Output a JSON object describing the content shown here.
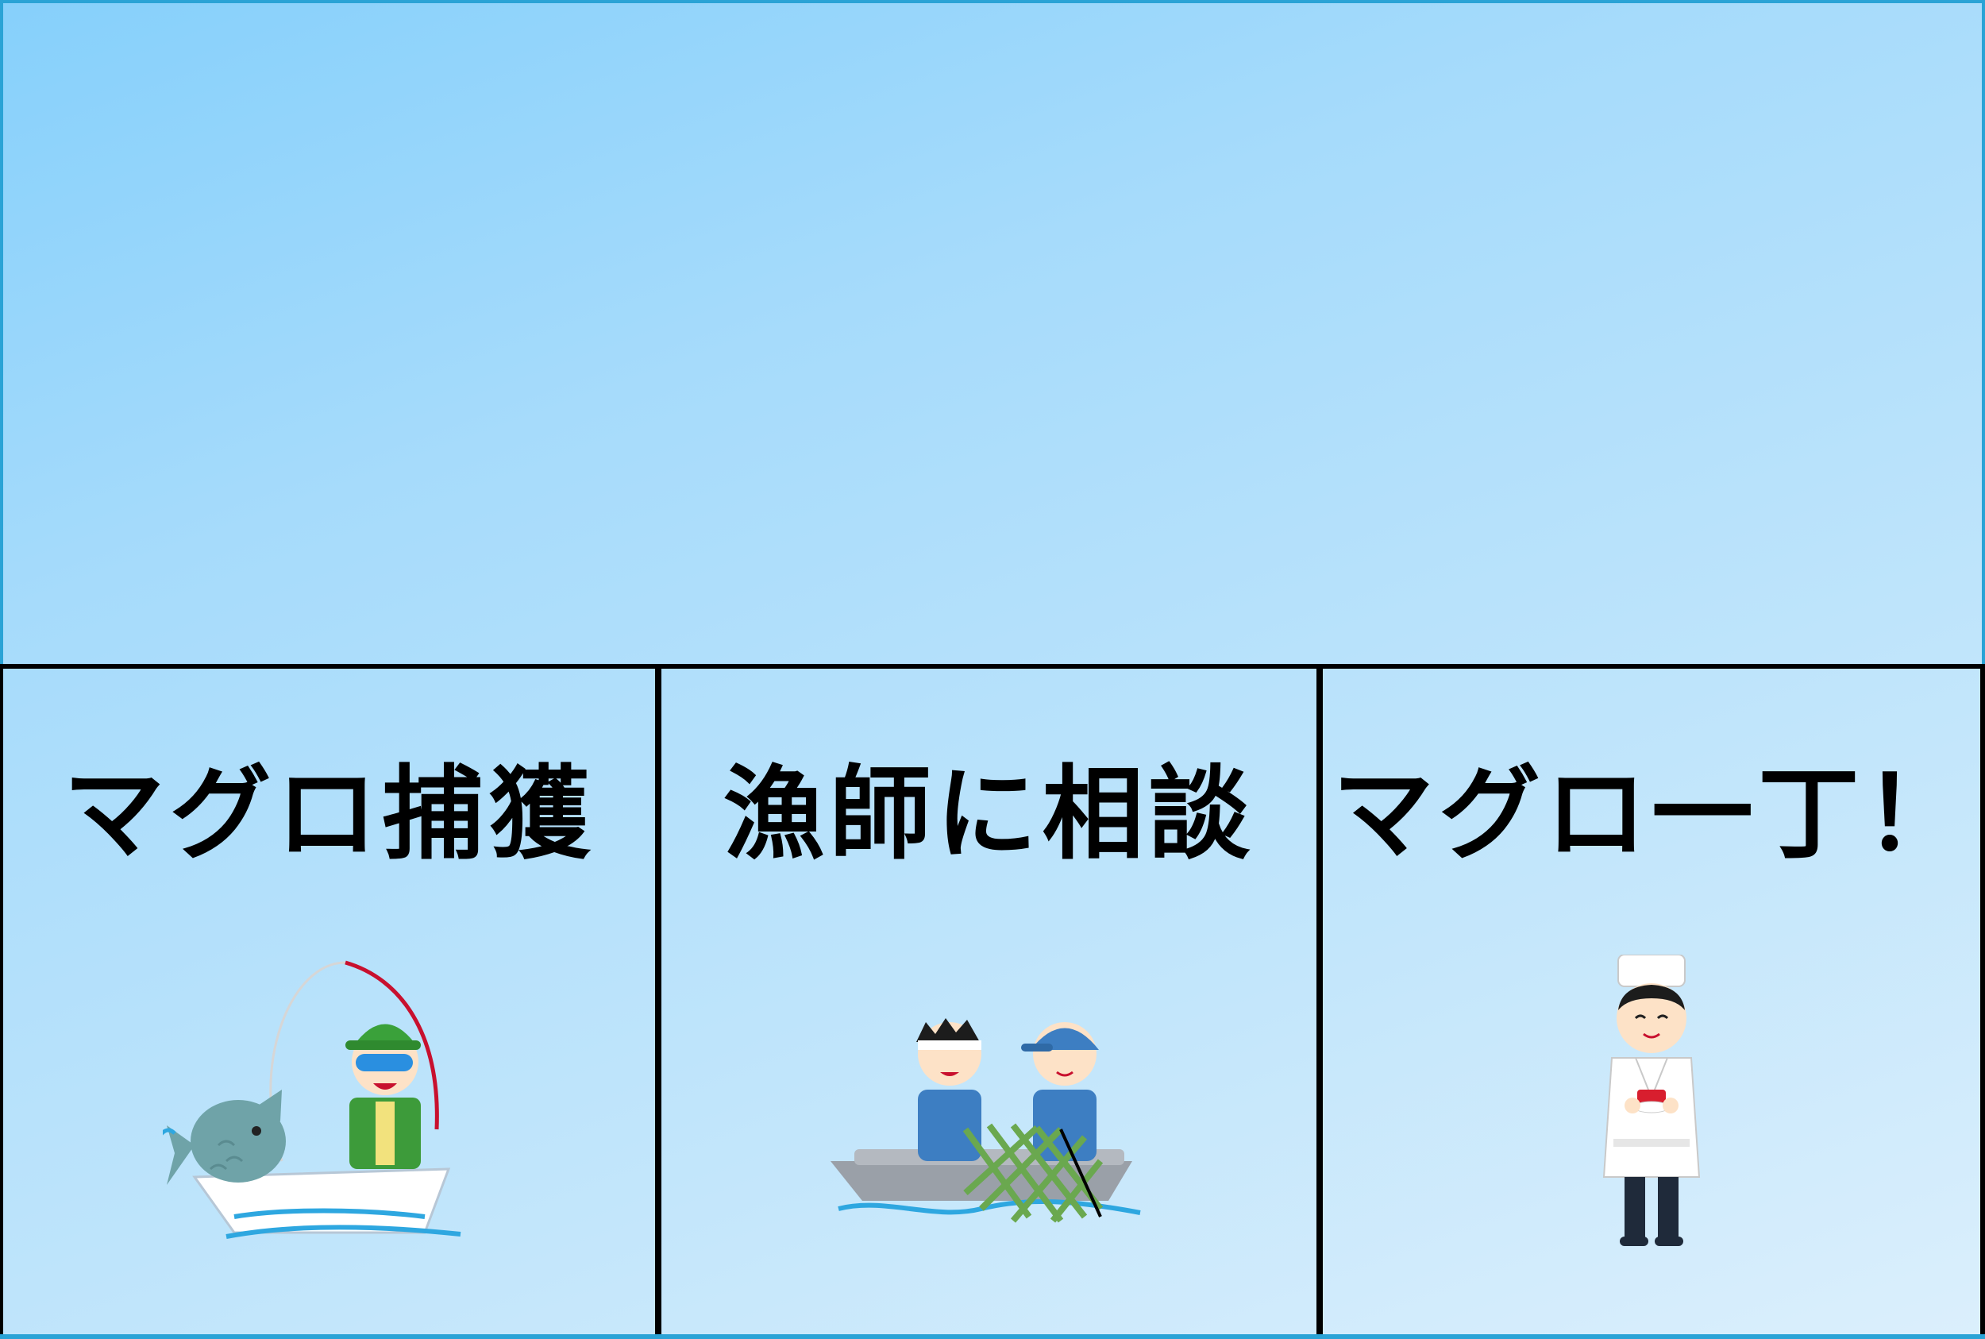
{
  "choices": [
    {
      "label": "マグロ捕獲",
      "icon": "angler-fishing-icon"
    },
    {
      "label": "漁師に相談",
      "icon": "fishermen-net-icon"
    },
    {
      "label": "マグロ一丁！",
      "icon": "sushi-chef-icon"
    }
  ],
  "colors": {
    "border": "#000000",
    "frame": "#2aa3d6",
    "background_start": "#86d0fb",
    "background_end": "#dbeffc"
  }
}
